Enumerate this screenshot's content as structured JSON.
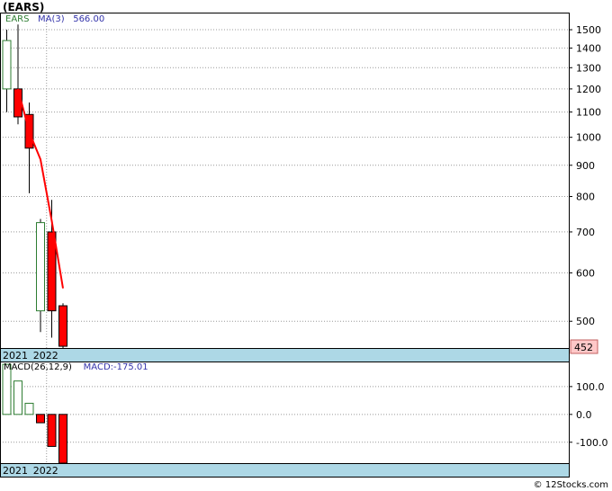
{
  "title": "(EARS)",
  "footer": "© 12Stocks.com",
  "colors": {
    "up": "#2e7d32",
    "down": "#ff0000",
    "ma": "#ff0000",
    "grid": "#999999",
    "band": "#add8e6",
    "last_badge": "#ffc8c8",
    "legend_symbol": "#2e7d32",
    "legend_value": "#3333aa"
  },
  "chart_data": [
    {
      "type": "candlestick",
      "name": "price",
      "legend": {
        "symbol": "EARS",
        "ma_label": "MA(3)",
        "ma_value": "566.00"
      },
      "y_scale": "log",
      "ylim": [
        452,
        1600
      ],
      "yticks": [
        1500,
        1400,
        1300,
        1200,
        1100,
        1000,
        900,
        800,
        700,
        600,
        500
      ],
      "x_labels": [
        "2021",
        "2022"
      ],
      "last_value": "452",
      "candles": [
        {
          "open": 1200,
          "high": 1500,
          "low": 1100,
          "close": 1440
        },
        {
          "open": 1200,
          "high": 1530,
          "low": 1050,
          "close": 1080
        },
        {
          "open": 1090,
          "high": 1140,
          "low": 810,
          "close": 960
        },
        {
          "open": 520,
          "high": 735,
          "low": 480,
          "close": 725
        },
        {
          "open": 700,
          "high": 790,
          "low": 470,
          "close": 520
        },
        {
          "open": 530,
          "high": 535,
          "low": 452,
          "close": 455
        }
      ],
      "ma": [
        {
          "index": 1,
          "value": 1200
        },
        {
          "index": 2,
          "value": 1020
        },
        {
          "index": 3,
          "value": 920
        },
        {
          "index": 4,
          "value": 730
        },
        {
          "index": 5,
          "value": 566
        }
      ]
    },
    {
      "type": "bar",
      "name": "macd",
      "legend": {
        "label": "MACD(26,12,9)",
        "value_label": "MACD:-175.01"
      },
      "ylim": [
        -175,
        190
      ],
      "yticks": [
        100.0,
        0.0,
        -100.0
      ],
      "ytick_labels": [
        "100.0",
        "0.0",
        "-100.0"
      ],
      "x_labels": [
        "2021",
        "2022"
      ],
      "values": [
        180,
        120,
        40,
        -30,
        -115,
        -175
      ]
    }
  ]
}
